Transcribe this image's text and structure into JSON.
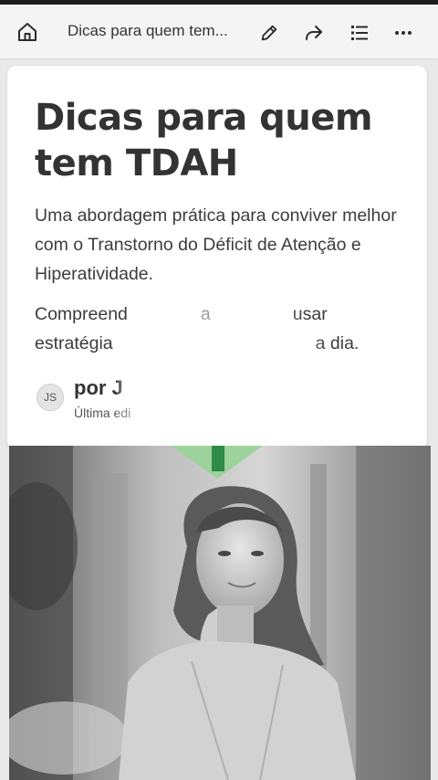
{
  "topbar": {
    "title": "Dicas para quem tem...",
    "icons": [
      "home-icon",
      "pencil-icon",
      "share-icon",
      "list-icon",
      "more-icon"
    ]
  },
  "card": {
    "headline": "Dicas para quem tem TDAH",
    "subtitle": "Uma abordagem prática para conviver melhor com o Transtorno do Déficit de Atenção e Hiperatividade.",
    "body_line1_a": "Compreend",
    "body_line1_b": "a",
    "body_line1_c": "usar",
    "body_line2_a": "estratégia",
    "body_line2_b": "a dia.",
    "avatar_initials": "JS",
    "author_prefix": "por J",
    "edited_prefix": "Última edi"
  },
  "colors": {
    "accent_green": "#9bd39b",
    "accent_green_dark": "#2f8b45",
    "background": "#e9e9e9"
  }
}
